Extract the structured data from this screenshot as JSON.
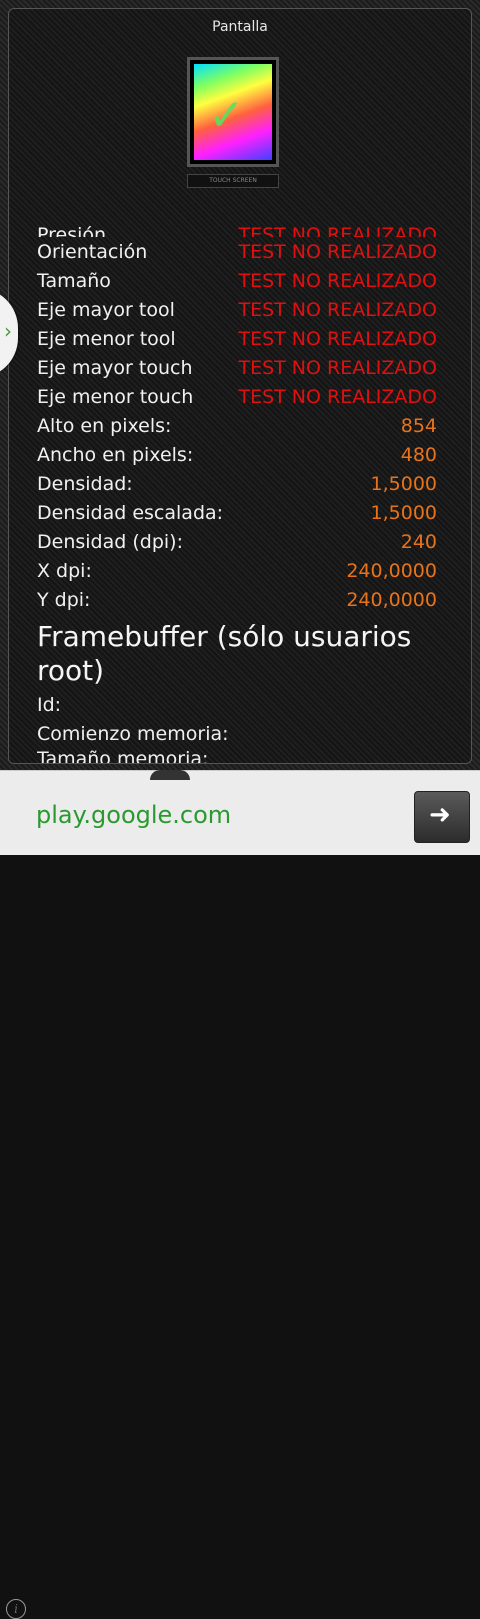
{
  "title": "Pantalla",
  "thumbnail_label": "TOUCH SCREEN",
  "rows": [
    {
      "label": "Presión",
      "value": "TEST NO REALIZADO",
      "status": "red"
    },
    {
      "label": "Orientación",
      "value": "TEST NO REALIZADO",
      "status": "red"
    },
    {
      "label": "Tamaño",
      "value": "TEST NO REALIZADO",
      "status": "red"
    },
    {
      "label": "Eje mayor tool",
      "value": "TEST NO REALIZADO",
      "status": "red"
    },
    {
      "label": "Eje menor tool",
      "value": "TEST NO REALIZADO",
      "status": "red"
    },
    {
      "label": "Eje mayor touch",
      "value": "TEST NO REALIZADO",
      "status": "red"
    },
    {
      "label": "Eje menor touch",
      "value": "TEST NO REALIZADO",
      "status": "red"
    },
    {
      "label": "Alto en pixels:",
      "value": "854",
      "status": "orange"
    },
    {
      "label": "Ancho en pixels:",
      "value": "480",
      "status": "orange"
    },
    {
      "label": "Densidad:",
      "value": "1,5000",
      "status": "orange"
    },
    {
      "label": "Densidad escalada:",
      "value": "1,5000",
      "status": "orange"
    },
    {
      "label": "Densidad (dpi):",
      "value": "240",
      "status": "orange"
    },
    {
      "label": "X dpi:",
      "value": "240,0000",
      "status": "orange"
    },
    {
      "label": "Y dpi:",
      "value": "240,0000",
      "status": "orange"
    }
  ],
  "section_title": "Framebuffer (sólo usuarios root)",
  "framebuffer_rows": [
    {
      "label": "Id:"
    },
    {
      "label": "Comienzo memoria:"
    },
    {
      "label": "Tamaño memoria:"
    }
  ],
  "ad": {
    "url": "play.google.com",
    "info_glyph": "i",
    "arrow_glyph": "➜"
  },
  "colors": {
    "red": "#e01010",
    "orange": "#e8731a",
    "ad_green": "#2a9a30"
  }
}
